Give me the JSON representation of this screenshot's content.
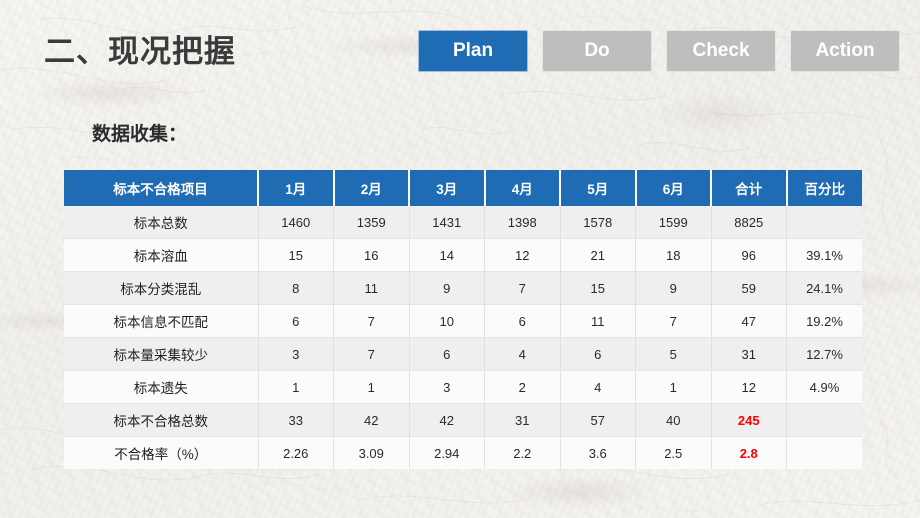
{
  "slide": {
    "title": "二、现况把握",
    "section_label": "数据收集：",
    "background_color": "#f4f3f0",
    "accent_color": "#1f6cb4",
    "inactive_tab_color": "#bebebe",
    "highlight_color": "#ff0000"
  },
  "pdca_tabs": [
    {
      "label": "Plan",
      "active": true
    },
    {
      "label": "Do",
      "active": false
    },
    {
      "label": "Check",
      "active": false
    },
    {
      "label": "Action",
      "active": false
    }
  ],
  "table": {
    "headers": [
      "标本不合格项目",
      "1月",
      "2月",
      "3月",
      "4月",
      "5月",
      "6月",
      "合计",
      "百分比"
    ],
    "rows": [
      {
        "label": "标本总数",
        "values": [
          "1460",
          "1359",
          "1431",
          "1398",
          "1578",
          "1599",
          "8825",
          ""
        ],
        "highlight": []
      },
      {
        "label": "标本溶血",
        "values": [
          "15",
          "16",
          "14",
          "12",
          "21",
          "18",
          "96",
          "39.1%"
        ],
        "highlight": []
      },
      {
        "label": "标本分类混乱",
        "values": [
          "8",
          "11",
          "9",
          "7",
          "15",
          "9",
          "59",
          "24.1%"
        ],
        "highlight": []
      },
      {
        "label": "标本信息不匹配",
        "values": [
          "6",
          "7",
          "10",
          "6",
          "11",
          "7",
          "47",
          "19.2%"
        ],
        "highlight": []
      },
      {
        "label": "标本量采集较少",
        "values": [
          "3",
          "7",
          "6",
          "4",
          "6",
          "5",
          "31",
          "12.7%"
        ],
        "highlight": []
      },
      {
        "label": "标本遗失",
        "values": [
          "1",
          "1",
          "3",
          "2",
          "4",
          "1",
          "12",
          "4.9%"
        ],
        "highlight": []
      },
      {
        "label": "标本不合格总数",
        "values": [
          "33",
          "42",
          "42",
          "31",
          "57",
          "40",
          "245",
          ""
        ],
        "highlight": [
          6
        ]
      },
      {
        "label": "不合格率（%）",
        "values": [
          "2.26",
          "3.09",
          "2.94",
          "2.2",
          "3.6",
          "2.5",
          "2.8",
          ""
        ],
        "highlight": [
          6
        ]
      }
    ]
  }
}
